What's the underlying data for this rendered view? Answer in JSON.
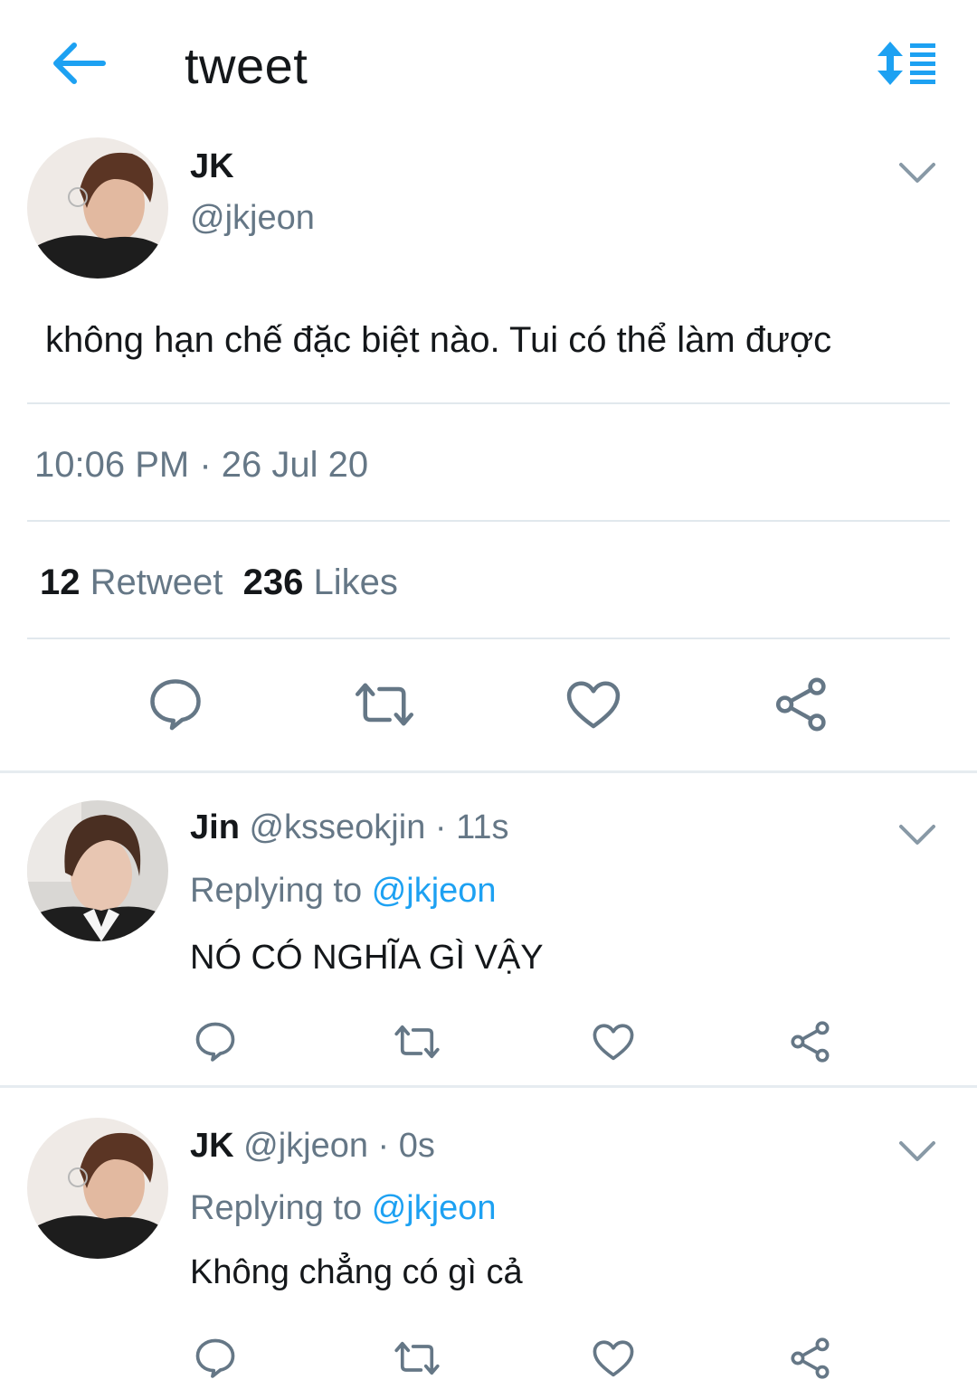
{
  "header": {
    "title": "tweet"
  },
  "tweet": {
    "author_name": "JK",
    "author_handle": "@jkjeon",
    "text": "không hạn chế đặc biệt nào. Tui có thể làm được",
    "timestamp": "10:06 PM · 26 Jul 20",
    "retweets_count": "12",
    "retweets_label": "Retweet",
    "likes_count": "236",
    "likes_label": "Likes"
  },
  "replies": [
    {
      "name": "Jin",
      "meta": "@ksseokjin · 11s",
      "replying_prefix": "Replying to",
      "replying_to": "@jkjeon",
      "text": "NÓ CÓ NGHĨA GÌ VẬY"
    },
    {
      "name": "JK",
      "meta": "@jkjeon · 0s",
      "replying_prefix": "Replying to",
      "replying_to": "@jkjeon",
      "text": "Không chẳng có gì cả"
    }
  ],
  "colors": {
    "accent": "#1da1f2",
    "secondary_text": "#657786",
    "primary_text": "#14171a",
    "divider": "#e1e8ed"
  },
  "icons": {
    "back": "arrow-left-icon",
    "sort": "sort-lines-icon",
    "menu": "chevron-down-icon",
    "reply": "speech-bubble-icon",
    "retweet": "retweet-icon",
    "like": "heart-icon",
    "share": "share-icon"
  }
}
